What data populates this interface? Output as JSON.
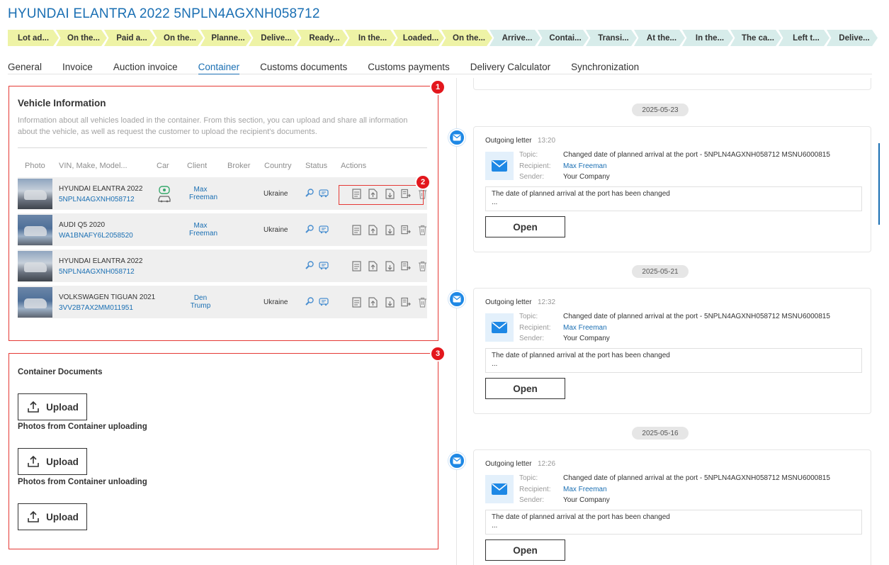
{
  "page": {
    "title": "HYUNDAI ELANTRA 2022 5NPLN4AGXNH058712"
  },
  "stages": [
    {
      "label": "Lot ad...",
      "state": "done"
    },
    {
      "label": "On the...",
      "state": "done"
    },
    {
      "label": "Paid a...",
      "state": "done"
    },
    {
      "label": "On the...",
      "state": "done"
    },
    {
      "label": "Planne...",
      "state": "done"
    },
    {
      "label": "Delive...",
      "state": "done"
    },
    {
      "label": "Ready...",
      "state": "done"
    },
    {
      "label": "In the...",
      "state": "done"
    },
    {
      "label": "Loaded...",
      "state": "done"
    },
    {
      "label": "On the...",
      "state": "done"
    },
    {
      "label": "Arrive...",
      "state": "todo"
    },
    {
      "label": "Contai...",
      "state": "todo"
    },
    {
      "label": "Transi...",
      "state": "todo"
    },
    {
      "label": "At the...",
      "state": "todo"
    },
    {
      "label": "In the...",
      "state": "todo"
    },
    {
      "label": "The ca...",
      "state": "todo"
    },
    {
      "label": "Left t...",
      "state": "todo"
    },
    {
      "label": "Delive...",
      "state": "todo"
    }
  ],
  "tabs": [
    {
      "label": "General",
      "active": false
    },
    {
      "label": "Invoice",
      "active": false
    },
    {
      "label": "Auction invoice",
      "active": false
    },
    {
      "label": "Container",
      "active": true
    },
    {
      "label": "Customs documents",
      "active": false
    },
    {
      "label": "Customs payments",
      "active": false
    },
    {
      "label": "Delivery Calculator",
      "active": false
    },
    {
      "label": "Synchronization",
      "active": false
    }
  ],
  "vehicle_info": {
    "badge": "1",
    "title": "Vehicle Information",
    "description": "Information about all vehicles loaded in the container. From this section, you can upload and share all information about the vehicle, as well as request the customer to upload the recipient's documents.",
    "columns": [
      "Photo",
      "VIN, Make, Model...",
      "Car",
      "Client",
      "Broker",
      "Country",
      "Status",
      "Actions"
    ],
    "actions_badge": "2",
    "rows": [
      {
        "model": "HYUNDAI ELANTRA 2022",
        "vin": "5NPLN4AGXNH058712",
        "client_first": "Max",
        "client_last": "Freeman",
        "country": "Ukraine",
        "has_car_icon": true
      },
      {
        "model": "AUDI Q5 2020",
        "vin": "WA1BNAFY6L2058520",
        "client_first": "Max",
        "client_last": "Freeman",
        "country": "Ukraine",
        "has_car_icon": false
      },
      {
        "model": "HYUNDAI ELANTRA 2022",
        "vin": "5NPLN4AGXNH058712",
        "client_first": "",
        "client_last": "",
        "country": "",
        "has_car_icon": false
      },
      {
        "model": "VOLKSWAGEN TIGUAN 2021",
        "vin": "3VV2B7AX2MM011951",
        "client_first": "Den",
        "client_last": "Trump",
        "country": "Ukraine",
        "has_car_icon": false
      }
    ]
  },
  "documents": {
    "badge": "3",
    "container_documents": "Container Documents",
    "photos_uploading": "Photos from Container uploading",
    "photos_unloading": "Photos from Container unloading",
    "upload_label": "Upload"
  },
  "timeline": [
    {
      "date": "2025-05-23",
      "type": "Outgoing letter",
      "time": "13:20",
      "topic_label": "Topic:",
      "topic": "Changed date of planned arrival at the port - 5NPLN4AGXNH058712 MSNU6000815",
      "recipient_label": "Recipient:",
      "recipient": "Max Freeman",
      "sender_label": "Sender:",
      "sender": "Your Company",
      "message": "The date of planned arrival at the port has been changed",
      "more": "...",
      "open_label": "Open"
    },
    {
      "date": "2025-05-21",
      "type": "Outgoing letter",
      "time": "12:32",
      "topic_label": "Topic:",
      "topic": "Changed date of planned arrival at the port - 5NPLN4AGXNH058712 MSNU6000815",
      "recipient_label": "Recipient:",
      "recipient": "Max Freeman",
      "sender_label": "Sender:",
      "sender": "Your Company",
      "message": "The date of planned arrival at the port has been changed",
      "more": "...",
      "open_label": "Open"
    },
    {
      "date": "2025-05-16",
      "type": "Outgoing letter",
      "time": "12:26",
      "topic_label": "Topic:",
      "topic": "Changed date of planned arrival at the port - 5NPLN4AGXNH058712 MSNU6000815",
      "recipient_label": "Recipient:",
      "recipient": "Max Freeman",
      "sender_label": "Sender:",
      "sender": "Your Company",
      "message": "The date of planned arrival at the port has been changed",
      "more": "...",
      "open_label": "Open"
    }
  ],
  "icons": {
    "status": [
      "search-icon",
      "car-document-icon"
    ],
    "actions": [
      "document-icon",
      "upload-file-icon",
      "download-file-icon",
      "share-file-icon",
      "trash-icon"
    ],
    "car_status": "car-status-icon",
    "mail": "mail-icon",
    "upload": "upload-icon"
  },
  "colors": {
    "accent": "#1a6fb3",
    "stage_done": "#eef3a6",
    "stage_todo": "#d7ecea",
    "highlight": "#e53935",
    "mail": "#1e88e5"
  }
}
